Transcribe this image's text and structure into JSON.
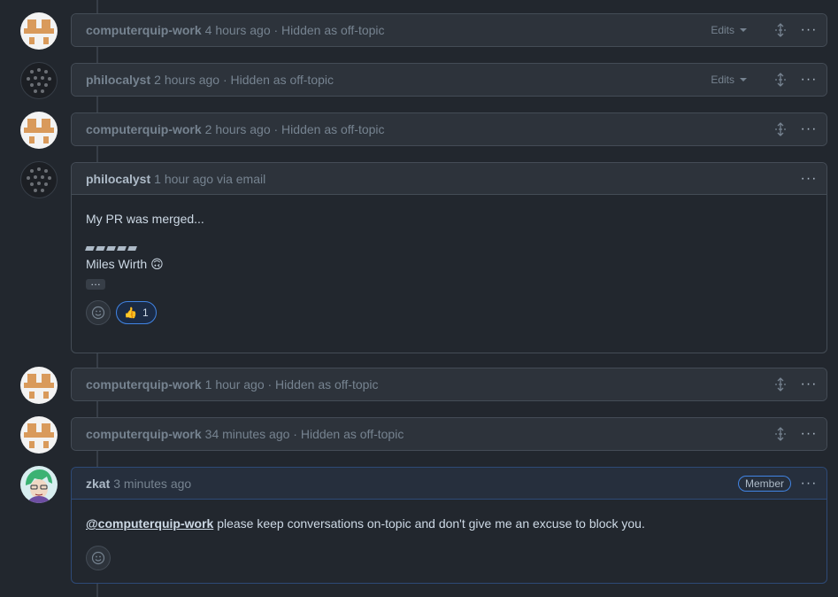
{
  "comments": [
    {
      "author": "computerquip-work",
      "meta": "4 hours ago · Hidden as off-topic",
      "edits_label": "Edits"
    },
    {
      "author": "philocalyst",
      "meta": "2 hours ago · Hidden as off-topic",
      "edits_label": "Edits"
    },
    {
      "author": "computerquip-work",
      "meta": "2 hours ago · Hidden as off-topic"
    },
    {
      "author": "philocalyst",
      "meta": "1 hour ago via email",
      "body_line1": "My PR was merged...",
      "signature_name": "Miles Wirth 🙃",
      "ellipsis": "…",
      "reaction": {
        "emoji": "👍",
        "count": "1"
      }
    },
    {
      "author": "computerquip-work",
      "meta": "1 hour ago · Hidden as off-topic"
    },
    {
      "author": "computerquip-work",
      "meta": "34 minutes ago · Hidden as off-topic"
    },
    {
      "author": "zkat",
      "meta": "3 minutes ago",
      "badge": "Member",
      "mention": "@computerquip-work",
      "body_text": " please keep conversations on-topic and don't give me an excuse to block you."
    }
  ],
  "more_glyph": "···",
  "icons": [
    "unfold-icon",
    "kebab-icon",
    "smiley-icon",
    "caret-down-icon"
  ]
}
